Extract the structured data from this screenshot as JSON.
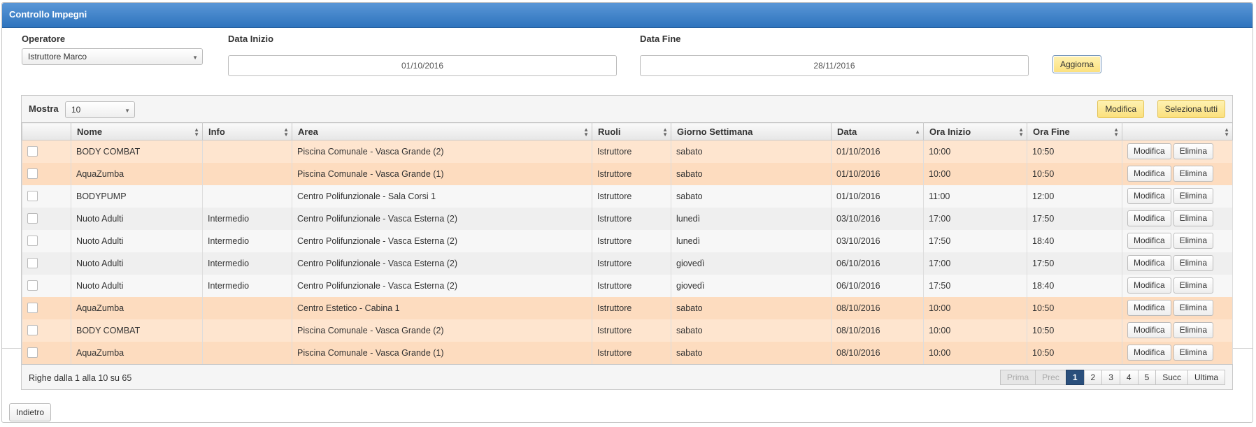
{
  "header": {
    "title": "Controllo Impegni"
  },
  "filters": {
    "operatore": {
      "label": "Operatore",
      "value": "Istruttore Marco"
    },
    "data_inizio": {
      "label": "Data Inizio",
      "value": "01/10/2016"
    },
    "data_fine": {
      "label": "Data Fine",
      "value": "28/11/2016"
    },
    "aggiorna_label": "Aggiorna"
  },
  "grid": {
    "mostra_label": "Mostra",
    "page_size": "10",
    "modifica_label": "Modifica",
    "seleziona_tutti_label": "Seleziona tutti",
    "columns": [
      "Nome",
      "Info",
      "Area",
      "Ruoli",
      "Giorno Settimana",
      "Data",
      "Ora Inizio",
      "Ora Fine"
    ],
    "row_modifica": "Modifica",
    "row_elimina": "Elimina",
    "rows": [
      {
        "nome": "BODY COMBAT",
        "info": "",
        "area": "Piscina Comunale - Vasca Grande (2)",
        "ruoli": "Istruttore",
        "giorno": "sabato",
        "data": "01/10/2016",
        "inizio": "10:00",
        "fine": "10:50",
        "highlight": true
      },
      {
        "nome": "AquaZumba",
        "info": "",
        "area": "Piscina Comunale - Vasca Grande (1)",
        "ruoli": "Istruttore",
        "giorno": "sabato",
        "data": "01/10/2016",
        "inizio": "10:00",
        "fine": "10:50",
        "highlight": true
      },
      {
        "nome": "BODYPUMP",
        "info": "",
        "area": "Centro Polifunzionale - Sala Corsi 1",
        "ruoli": "Istruttore",
        "giorno": "sabato",
        "data": "01/10/2016",
        "inizio": "11:00",
        "fine": "12:00",
        "highlight": false
      },
      {
        "nome": "Nuoto Adulti",
        "info": "Intermedio",
        "area": "Centro Polifunzionale - Vasca Esterna (2)",
        "ruoli": "Istruttore",
        "giorno": "lunedì",
        "data": "03/10/2016",
        "inizio": "17:00",
        "fine": "17:50",
        "highlight": false
      },
      {
        "nome": "Nuoto Adulti",
        "info": "Intermedio",
        "area": "Centro Polifunzionale - Vasca Esterna (2)",
        "ruoli": "Istruttore",
        "giorno": "lunedì",
        "data": "03/10/2016",
        "inizio": "17:50",
        "fine": "18:40",
        "highlight": false
      },
      {
        "nome": "Nuoto Adulti",
        "info": "Intermedio",
        "area": "Centro Polifunzionale - Vasca Esterna (2)",
        "ruoli": "Istruttore",
        "giorno": "giovedì",
        "data": "06/10/2016",
        "inizio": "17:00",
        "fine": "17:50",
        "highlight": false
      },
      {
        "nome": "Nuoto Adulti",
        "info": "Intermedio",
        "area": "Centro Polifunzionale - Vasca Esterna (2)",
        "ruoli": "Istruttore",
        "giorno": "giovedì",
        "data": "06/10/2016",
        "inizio": "17:50",
        "fine": "18:40",
        "highlight": false
      },
      {
        "nome": "AquaZumba",
        "info": "",
        "area": "Centro Estetico - Cabina 1",
        "ruoli": "Istruttore",
        "giorno": "sabato",
        "data": "08/10/2016",
        "inizio": "10:00",
        "fine": "10:50",
        "highlight": true
      },
      {
        "nome": "BODY COMBAT",
        "info": "",
        "area": "Piscina Comunale - Vasca Grande (2)",
        "ruoli": "Istruttore",
        "giorno": "sabato",
        "data": "08/10/2016",
        "inizio": "10:00",
        "fine": "10:50",
        "highlight": true
      },
      {
        "nome": "AquaZumba",
        "info": "",
        "area": "Piscina Comunale - Vasca Grande (1)",
        "ruoli": "Istruttore",
        "giorno": "sabato",
        "data": "08/10/2016",
        "inizio": "10:00",
        "fine": "10:50",
        "highlight": true
      }
    ],
    "summary": "Righe dalla 1 alla 10 su 65",
    "pager": {
      "prima": "Prima",
      "prec": "Prec",
      "pages": [
        "1",
        "2",
        "3",
        "4",
        "5"
      ],
      "active_page": "1",
      "succ": "Succ",
      "ultima": "Ultima"
    }
  },
  "footer": {
    "indietro_label": "Indietro"
  },
  "colors": {
    "header_blue": "#2e74bd",
    "highlight_row": "#fee5cf",
    "active_page": "#2a4f7c",
    "button_yellow": "#fbe07d"
  }
}
